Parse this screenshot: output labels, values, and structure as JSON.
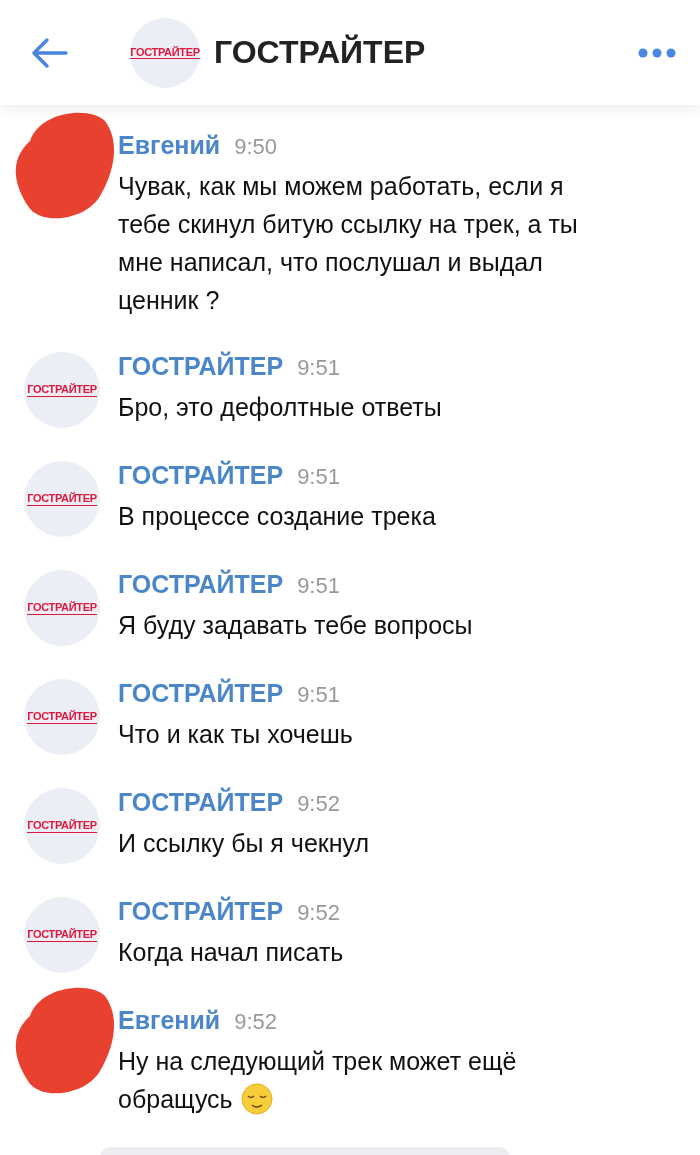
{
  "header": {
    "title": "ГОСТРАЙТЕР",
    "avatar": {
      "kind": "logo",
      "logo_text": "ГОСТРАЙТЕР"
    }
  },
  "messages": [
    {
      "author": "Евгений",
      "time": "9:50",
      "avatar": {
        "kind": "redacted"
      },
      "lines": [
        "Чувак, как мы можем работать, если я",
        "тебе скинул битую ссылку на трек, а ты",
        "мне написал, что послушал и выдал",
        "ценник ?"
      ]
    },
    {
      "author": "ГОСТРАЙТЕР",
      "time": "9:51",
      "avatar": {
        "kind": "logo",
        "logo_text": "ГОСТРАЙТЕР"
      },
      "lines": [
        "Бро, это дефолтные ответы"
      ]
    },
    {
      "author": "ГОСТРАЙТЕР",
      "time": "9:51",
      "avatar": {
        "kind": "logo",
        "logo_text": "ГОСТРАЙТЕР"
      },
      "lines": [
        "В процессе создание трека"
      ]
    },
    {
      "author": "ГОСТРАЙТЕР",
      "time": "9:51",
      "avatar": {
        "kind": "logo",
        "logo_text": "ГОСТРАЙТЕР"
      },
      "lines": [
        "Я буду задавать тебе вопросы"
      ]
    },
    {
      "author": "ГОСТРАЙТЕР",
      "time": "9:51",
      "avatar": {
        "kind": "logo",
        "logo_text": "ГОСТРАЙТЕР"
      },
      "lines": [
        "Что и как ты хочешь"
      ]
    },
    {
      "author": "ГОСТРАЙТЕР",
      "time": "9:52",
      "avatar": {
        "kind": "logo",
        "logo_text": "ГОСТРАЙТЕР"
      },
      "lines": [
        "И ссылку бы я чекнул"
      ]
    },
    {
      "author": "ГОСТРАЙТЕР",
      "time": "9:52",
      "avatar": {
        "kind": "logo",
        "logo_text": "ГОСТРАЙТЕР"
      },
      "lines": [
        "Когда начал писать"
      ]
    },
    {
      "author": "Евгений",
      "time": "9:52",
      "avatar": {
        "kind": "redacted"
      },
      "lines": [
        "Ну на следующий трек может ещё",
        "обращусь"
      ],
      "has_emoji": true
    }
  ]
}
